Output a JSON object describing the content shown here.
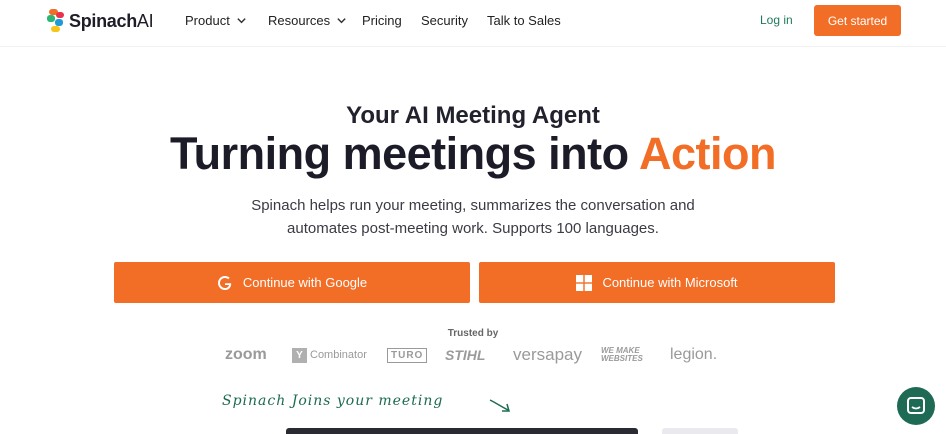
{
  "brand": {
    "name": "Spinach",
    "suffix": "AI"
  },
  "nav": {
    "items": [
      {
        "label": "Product",
        "has_dropdown": true
      },
      {
        "label": "Resources",
        "has_dropdown": true
      },
      {
        "label": "Pricing",
        "has_dropdown": false
      },
      {
        "label": "Security",
        "has_dropdown": false
      },
      {
        "label": "Talk to Sales",
        "has_dropdown": false
      }
    ],
    "login": "Log in",
    "cta": "Get started"
  },
  "hero": {
    "eyebrow": "Your AI Meeting Agent",
    "headline": "Turning meetings into",
    "headline_accent": "Action",
    "subtext_line1": "Spinach helps run your meeting, summarizes the conversation and",
    "subtext_line2": "automates post-meeting work. Supports 100 languages.",
    "google_button": "Continue with Google",
    "microsoft_button": "Continue with Microsoft"
  },
  "trusted": {
    "label": "Trusted by",
    "logos": [
      "zoom",
      "Combinator",
      "TURO",
      "STIHL",
      "versapay",
      "WE MAKE WEBSITES",
      "legion."
    ]
  },
  "script_caption": "Spinach Joins your meeting",
  "colors": {
    "accent": "#f26d26",
    "brand_green": "#1f6a55",
    "link_green": "#1f7a5c"
  },
  "icons": [
    "spinach-logo-icon",
    "chevron-down-icon",
    "google-icon",
    "microsoft-icon",
    "arrow-icon",
    "chat-icon"
  ]
}
